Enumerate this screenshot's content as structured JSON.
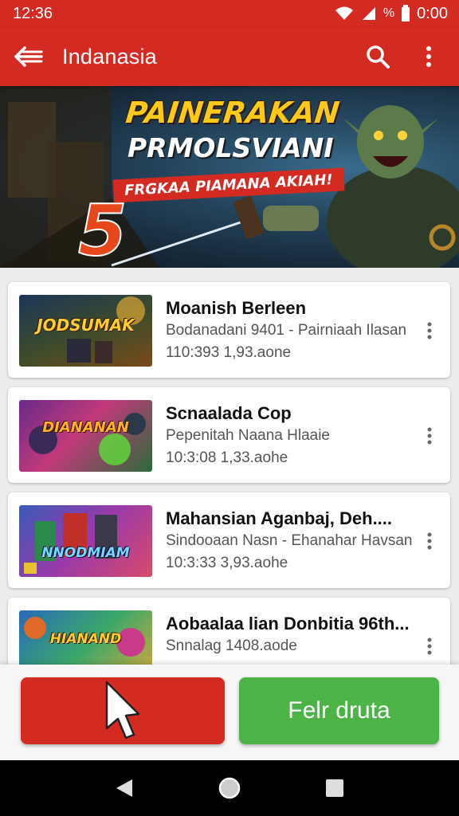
{
  "status_bar": {
    "time": "12:36",
    "battery_text": "0:00",
    "percent_symbol": "%"
  },
  "app_bar": {
    "title": "Indanasia"
  },
  "banner": {
    "number": "5",
    "headline_line1": "PAINERAKAN",
    "headline_line2": "PRMOLSVIANI",
    "ribbon": "FRGKAA PIAMANA AKIAH!"
  },
  "games": [
    {
      "name": "Moanish Berleen",
      "subtitle": "Bodanadani 9401 - Pairniaah Ilasan",
      "meta": "110:393 1,93.aone",
      "thumb_label": "JODSUMAK"
    },
    {
      "name": "Scnaalada Cop",
      "subtitle": "Pepenitah Naana Hlaaie",
      "meta": "10:3:08 1,33.aohe",
      "thumb_label": "DIANANAN"
    },
    {
      "name": "Mahansian Aganbaj, Deh....",
      "subtitle": "Sindooaan Nasn - Ehanahar Havsan",
      "meta": "10:3:33 3,93.aohe",
      "thumb_label": "NNODMIAM"
    },
    {
      "name": "Aobaalaa lian Donbitia 96th...",
      "subtitle": "Snnalag 1408.aode",
      "meta": "",
      "thumb_label": "HIANAND"
    }
  ],
  "actions": {
    "secondary_label": "Felr druta"
  },
  "colors": {
    "primary": "#d32a22",
    "accent_green": "#4cb347",
    "nav": "#000000"
  }
}
